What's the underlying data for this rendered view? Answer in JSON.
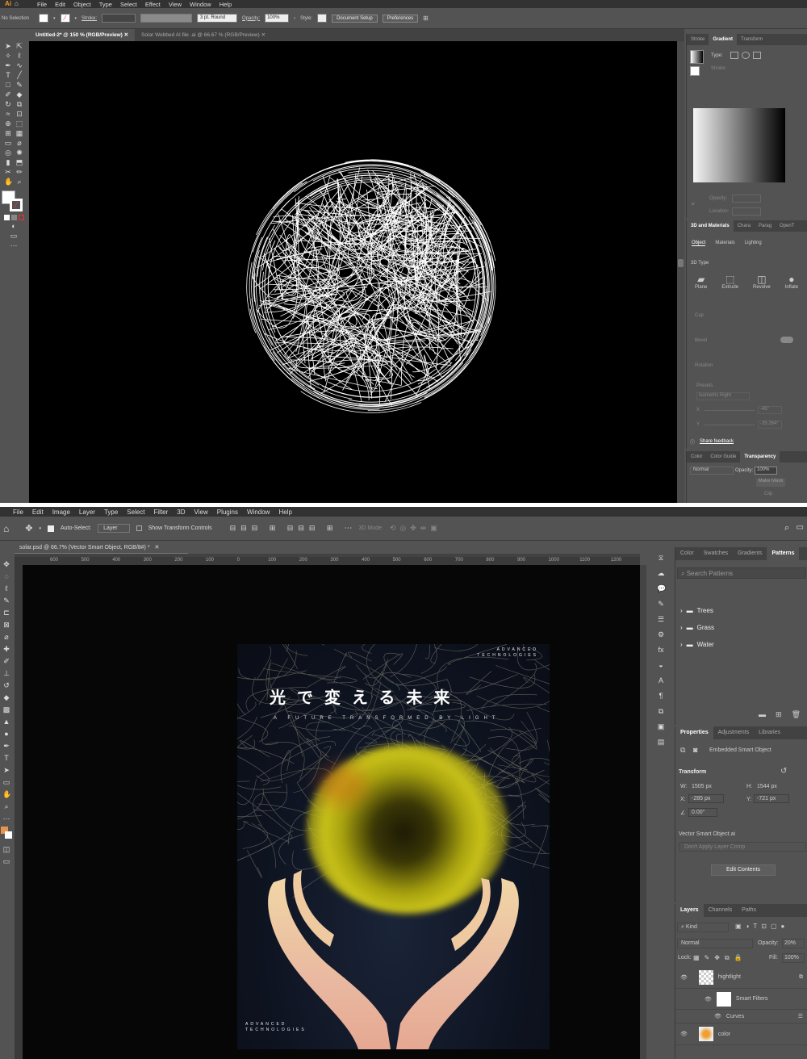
{
  "ai": {
    "menu": [
      "File",
      "Edit",
      "Object",
      "Type",
      "Select",
      "Effect",
      "View",
      "Window",
      "Help"
    ],
    "control": {
      "selection": "No Selection",
      "stroke_label": "Stroke:",
      "brush": "3 pt. Round",
      "opacity_label": "Opacity:",
      "opacity": "100%",
      "style_label": "Style:",
      "document_setup": "Document Setup",
      "preferences": "Preferences"
    },
    "tabs": [
      {
        "label": "Untitled-2* @ 150 % (RGB/Preview)",
        "active": true
      },
      {
        "label": "Solar Webbed AI file .ai @ 66.67 % (RGB/Preview)",
        "active": false
      }
    ],
    "gradient_panel": {
      "tabs": [
        "Stroke",
        "Gradient",
        "Transform"
      ],
      "type_label": "Type:",
      "stroke_label": "Stroke:",
      "opacity_label": "Opacity:",
      "location_label": "Location:"
    },
    "materials_panel": {
      "tabs": [
        "3D and Materials",
        "Chara",
        "Parag",
        "OpenT"
      ],
      "subtabs": [
        "Object",
        "Materials",
        "Lighting"
      ],
      "section": "3D Type",
      "types": [
        "Plane",
        "Extrude",
        "Revolve",
        "Inflate"
      ],
      "cap": "Cap",
      "bevel": "Bevel",
      "rotation": "Rotation",
      "presets": "Presets",
      "preset_value": "Isometric Right",
      "x_label": "X",
      "x_value": "-45°",
      "y_label": "Y",
      "y_value": "-35.264°",
      "feedback": "Share feedback"
    },
    "transparency_panel": {
      "tabs": [
        "Color",
        "Color Guide",
        "Transparency"
      ],
      "mode": "Normal",
      "opacity_label": "Opacity:",
      "opacity": "100%",
      "make_mask": "Make Mask",
      "clip": "Clip"
    }
  },
  "ps": {
    "menu": [
      "File",
      "Edit",
      "Image",
      "Layer",
      "Type",
      "Select",
      "Filter",
      "3D",
      "View",
      "Plugins",
      "Window",
      "Help"
    ],
    "options": {
      "auto_select": "Auto-Select:",
      "layer": "Layer",
      "show_transform": "Show Transform Controls",
      "mode_3d": "3D Mode:"
    },
    "tab": "solar.psd @ 66.7% (Vector Smart Object, RGB/8#) *",
    "ruler_labels": [
      "600",
      "500",
      "400",
      "300",
      "200",
      "100",
      "0",
      "100",
      "200",
      "300",
      "400",
      "500",
      "600",
      "700",
      "800",
      "900",
      "1000",
      "1100",
      "1200"
    ],
    "poster": {
      "brand_top": "ADVANCED\nTECHNOLOGIES",
      "title_jp": "光で変える未来",
      "subtitle": "A FUTURE TRANSFORMED BY LIGHT",
      "brand_bottom": "ADVANCED\nTECHNOLOGIES"
    },
    "patterns_panel": {
      "tabs": [
        "Color",
        "Swatches",
        "Gradients",
        "Patterns"
      ],
      "search_placeholder": "Search Patterns",
      "folders": [
        "Trees",
        "Grass",
        "Water"
      ]
    },
    "properties_panel": {
      "tabs": [
        "Properties",
        "Adjustments",
        "Libraries"
      ],
      "object_type": "Embedded Smart Object",
      "transform_title": "Transform",
      "w_label": "W:",
      "w": "1505 px",
      "h_label": "H:",
      "h": "1544 px",
      "x_label": "X:",
      "x": "-285 px",
      "y_label": "Y:",
      "y": "-721 px",
      "angle": "0.00°",
      "file": "Vector Smart Object.ai",
      "layer_comp": "Don't Apply Layer Comp",
      "edit_contents": "Edit Contents"
    },
    "layers_panel": {
      "tabs": [
        "Layers",
        "Channels",
        "Paths"
      ],
      "kind": "Kind",
      "blend": "Normal",
      "opacity_label": "Opacity:",
      "opacity": "20%",
      "lock_label": "Lock:",
      "fill_label": "Fill:",
      "fill": "100%",
      "layers": [
        {
          "name": "hightlight",
          "indent": 0
        },
        {
          "name": "Smart Filters",
          "indent": 1
        },
        {
          "name": "Curves",
          "indent": 2
        },
        {
          "name": "color",
          "indent": 0
        }
      ]
    }
  }
}
